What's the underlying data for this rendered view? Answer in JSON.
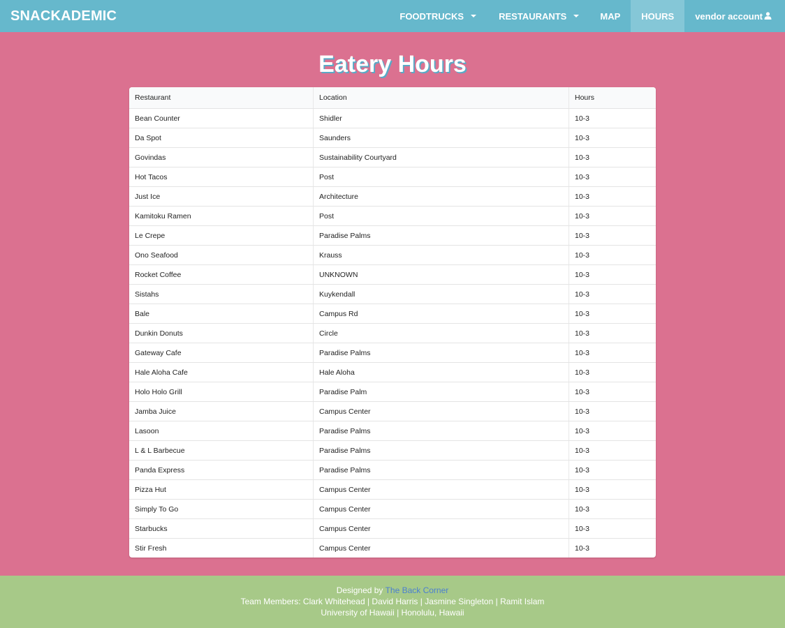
{
  "nav": {
    "brand": "SNACKADEMIC",
    "items": [
      {
        "label": "FOODTRUCKS"
      },
      {
        "label": "RESTAURANTS"
      },
      {
        "label": "MAP"
      },
      {
        "label": "HOURS"
      },
      {
        "label": "vendor account"
      }
    ]
  },
  "page": {
    "title": "Eatery Hours"
  },
  "table": {
    "headers": [
      "Restaurant",
      "Location",
      "Hours"
    ],
    "rows": [
      [
        "Bean Counter",
        "Shidler",
        "10-3"
      ],
      [
        "Da Spot",
        "Saunders",
        "10-3"
      ],
      [
        "Govindas",
        "Sustainability Courtyard",
        "10-3"
      ],
      [
        "Hot Tacos",
        "Post",
        "10-3"
      ],
      [
        "Just Ice",
        "Architecture",
        "10-3"
      ],
      [
        "Kamitoku Ramen",
        "Post",
        "10-3"
      ],
      [
        "Le Crepe",
        "Paradise Palms",
        "10-3"
      ],
      [
        "Ono Seafood",
        "Krauss",
        "10-3"
      ],
      [
        "Rocket Coffee",
        "UNKNOWN",
        "10-3"
      ],
      [
        "Sistahs",
        "Kuykendall",
        "10-3"
      ],
      [
        "Bale",
        "Campus Rd",
        "10-3"
      ],
      [
        "Dunkin Donuts",
        "Circle",
        "10-3"
      ],
      [
        "Gateway Cafe",
        "Paradise Palms",
        "10-3"
      ],
      [
        "Hale Aloha Cafe",
        "Hale Aloha",
        "10-3"
      ],
      [
        "Holo Holo Grill",
        "Paradise Palm",
        "10-3"
      ],
      [
        "Jamba Juice",
        "Campus Center",
        "10-3"
      ],
      [
        "Lasoon",
        "Paradise Palms",
        "10-3"
      ],
      [
        "L & L Barbecue",
        "Paradise Palms",
        "10-3"
      ],
      [
        "Panda Express",
        "Paradise Palms",
        "10-3"
      ],
      [
        "Pizza Hut",
        "Campus Center",
        "10-3"
      ],
      [
        "Simply To Go",
        "Campus Center",
        "10-3"
      ],
      [
        "Starbucks",
        "Campus Center",
        "10-3"
      ],
      [
        "Stir Fresh",
        "Campus Center",
        "10-3"
      ]
    ]
  },
  "footer": {
    "designed_by_prefix": "Designed by",
    "designed_by_link": "The Back Corner",
    "team": "Team Members: Clark Whitehead | David Harris | Jasmine Singleton | Ramit Islam",
    "location": "University of Hawaii | Honolulu, Hawaii"
  },
  "icons": {
    "dropdown": "chevron-down-icon",
    "user": "user-icon"
  },
  "colors": {
    "navbar": "#66b8cc",
    "navbar_active": "#85c7d7",
    "background": "#db7190",
    "footer": "#a7c988",
    "title_shadow": "#5aa9c6",
    "link": "#4a7fd0"
  }
}
